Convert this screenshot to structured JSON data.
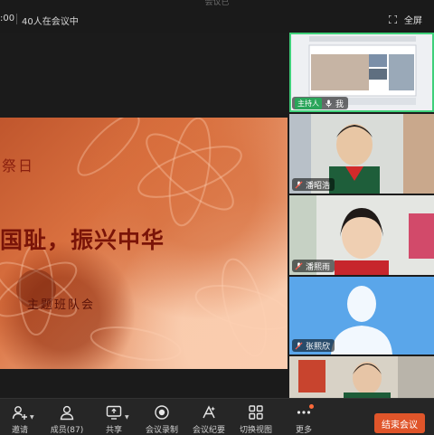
{
  "topbar": {
    "title": "会议已",
    "time": ":00",
    "participant_count": "40人在会议中",
    "fullscreen_label": "全屏"
  },
  "slide": {
    "day_text": "祭日",
    "title": "国耻，振兴中华",
    "subtitle": "主题班队会"
  },
  "participants": [
    {
      "name": "我",
      "badge": "主持人",
      "muted": false,
      "screen_share": true
    },
    {
      "name": "潘昭浩",
      "muted": true
    },
    {
      "name": "潘熙雨",
      "muted": true
    },
    {
      "name": "张熙欣",
      "muted": true,
      "avatar_placeholder": true
    },
    {
      "name": ""
    }
  ],
  "toolbar": {
    "items": [
      {
        "label": "邀请",
        "icon": "add-user-icon"
      },
      {
        "label": "成员(87)",
        "icon": "members-icon"
      },
      {
        "label": "共享",
        "icon": "share-screen-icon"
      },
      {
        "label": "会议录制",
        "icon": "record-icon"
      },
      {
        "label": "会议纪要",
        "icon": "ai-notes-icon"
      },
      {
        "label": "切换视图",
        "icon": "view-grid-icon"
      },
      {
        "label": "更多",
        "icon": "more-icon"
      }
    ],
    "end_label": "结束会议"
  },
  "colors": {
    "accent_end": "#e0552a",
    "host_green": "#2aa55a",
    "active_outline": "#3fd07a"
  }
}
